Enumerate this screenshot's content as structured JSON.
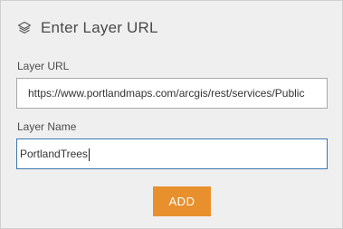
{
  "dialog": {
    "icon": "layers-icon",
    "title": "Enter Layer URL"
  },
  "layer_url": {
    "label": "Layer URL",
    "value": "https://www.portlandmaps.com/arcgis/rest/services/Public"
  },
  "layer_name": {
    "label": "Layer Name",
    "value": "PortlandTrees"
  },
  "actions": {
    "add_label": "ADD",
    "add_color": "#e8902d"
  },
  "colors": {
    "panel_background": "#efefef",
    "focus_border": "#3b78b0"
  }
}
